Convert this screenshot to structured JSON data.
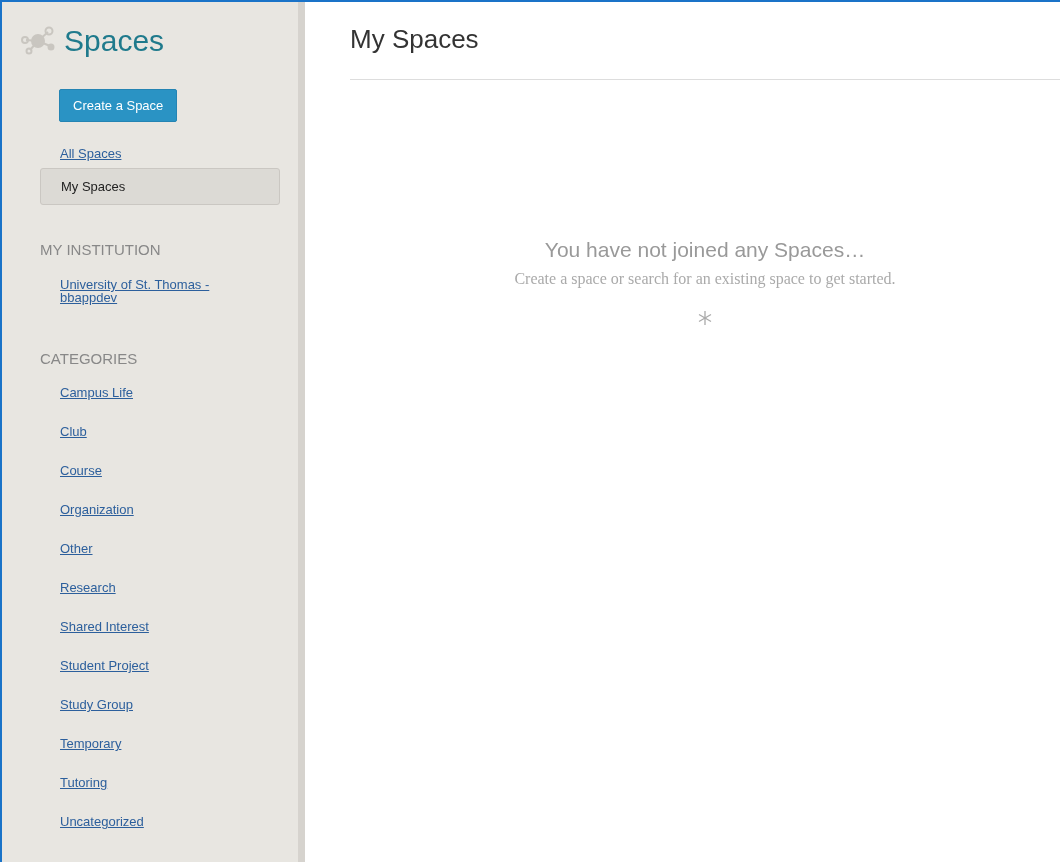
{
  "sidebar": {
    "title": "Spaces",
    "create_button": "Create a Space",
    "nav": [
      {
        "label": "All Spaces",
        "selected": false
      },
      {
        "label": "My Spaces",
        "selected": true
      }
    ],
    "institution": {
      "heading": "MY INSTITUTION",
      "items": [
        "University of St. Thomas - bbappdev"
      ]
    },
    "categories": {
      "heading": "CATEGORIES",
      "items": [
        "Campus Life",
        "Club",
        "Course",
        "Organization",
        "Other",
        "Research",
        "Shared Interest",
        "Student Project",
        "Study Group",
        "Temporary",
        "Tutoring",
        "Uncategorized"
      ]
    }
  },
  "main": {
    "title": "My Spaces",
    "empty_title": "You have not joined any Spaces…",
    "empty_text": "Create a space or search for an existing space to get started."
  }
}
